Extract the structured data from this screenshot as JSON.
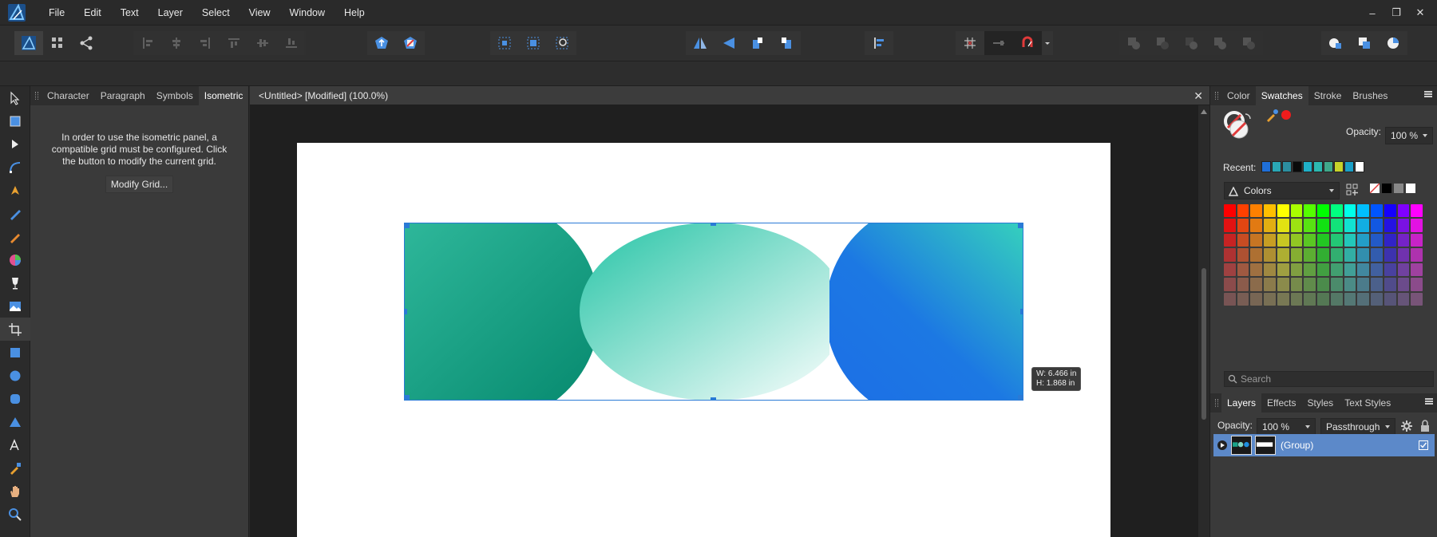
{
  "menubar": {
    "items": [
      "File",
      "Edit",
      "Text",
      "Layer",
      "Select",
      "View",
      "Window",
      "Help"
    ],
    "window_controls": [
      "–",
      "❐",
      "✕"
    ]
  },
  "left_panel": {
    "tabs": [
      "Character",
      "Paragraph",
      "Symbols",
      "Isometric"
    ],
    "active_tab": "Isometric",
    "message": "In order to use the isometric panel, a compatible grid must be configured. Click the button to modify the current grid.",
    "button_label": "Modify Grid..."
  },
  "document": {
    "title": "<Untitled> [Modified] (100.0%)",
    "close_label": "✕"
  },
  "selection_tooltip": {
    "width": "W: 6.466 in",
    "height": "H: 1.868 in"
  },
  "right_panel": {
    "tabs": [
      "Color",
      "Swatches",
      "Stroke",
      "Brushes"
    ],
    "active_tab": "Swatches",
    "opacity_label": "Opacity:",
    "opacity_value": "100 %",
    "recent_label": "Recent:",
    "recent_colors": [
      "#1f6fd8",
      "#2aa7b5",
      "#2c8fa0",
      "#0a0a0a",
      "#1fb0c8",
      "#2cb8b0",
      "#3fa88a",
      "#c8d22a",
      "#1aa0c8",
      "#ffffff"
    ],
    "palette_name": "Colors",
    "search_placeholder": "Search"
  },
  "layers_panel": {
    "tabs": [
      "Layers",
      "Effects",
      "Styles",
      "Text Styles"
    ],
    "active_tab": "Layers",
    "opacity_label": "Opacity:",
    "opacity_value": "100 %",
    "blend_mode": "Passthrough",
    "layers": [
      {
        "name": "(Group)",
        "visible": true
      }
    ]
  },
  "colors": {
    "accent": "#5c89c9",
    "selection": "#2a7ad6"
  }
}
